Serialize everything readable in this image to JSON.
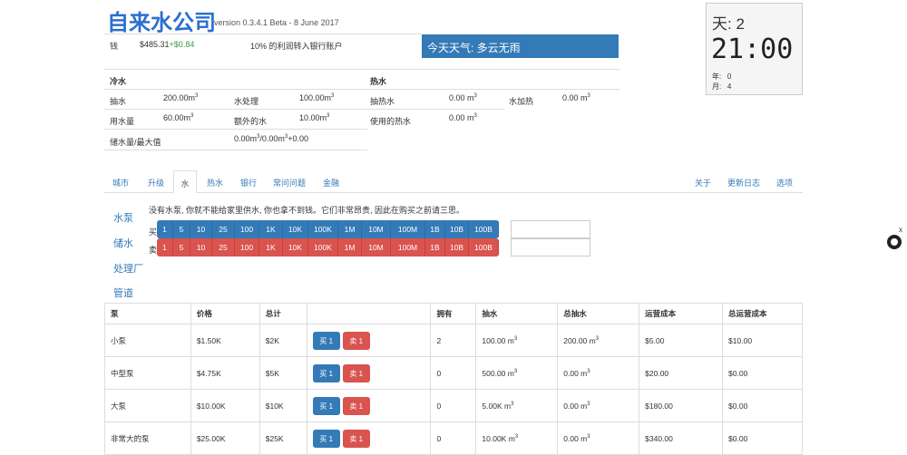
{
  "header": {
    "title": "自来水公司",
    "version": "version 0.3.4.1 Beta - 8 June 2017"
  },
  "money": {
    "label": "钱",
    "amount": "$485.31",
    "delta": "+$0.84",
    "bank_note": "10% 的利润转入银行账户"
  },
  "weather": {
    "text": "今天天气: 多云无雨"
  },
  "clock": {
    "day_label": "天: 2",
    "time": "21:00",
    "year_label": "年:",
    "year_value": "0",
    "month_label": "月:",
    "month_value": "4"
  },
  "cold": {
    "heading": "冷水",
    "pump_label": "抽水",
    "pump_value": "200.00m",
    "treat_label": "水处理",
    "treat_value": "100.00m",
    "usage_label": "用水量",
    "usage_value": "60.00m",
    "extra_label": "额外的水",
    "extra_value": "10.00m",
    "storage_label": "储水量/最大值",
    "storage_value_a": "0.00m",
    "storage_value_b": "/0.00m",
    "storage_value_c": "+0.00",
    "sup3": "3"
  },
  "hot": {
    "heading": "热水",
    "pump_label": "抽热水",
    "pump_value": "0.00 m",
    "heat_label": "水加热",
    "heat_value": "0.00 m",
    "used_label": "使用的热水",
    "used_value": "0.00 m"
  },
  "tabs": {
    "city": "城市",
    "upgrade": "升级",
    "water": "水",
    "hot_water": "热水",
    "bank": "银行",
    "faq": "常问问题",
    "finance": "金融",
    "about": "关于",
    "changelog": "更新日志",
    "options": "选项"
  },
  "side": {
    "pump": "水泵",
    "storage": "储水",
    "treatment": "处理厂",
    "pipe": "管道"
  },
  "notice": "没有水泵, 你就不能给家里供水, 你也拿不到钱。它们非常昂贵, 因此在购买之前请三思。",
  "quantity": {
    "buy_label": "买",
    "sell_label": "卖",
    "options": [
      "1",
      "5",
      "10",
      "25",
      "100",
      "1K",
      "10K",
      "100K",
      "1M",
      "10M",
      "100M",
      "1B",
      "10B",
      "100B"
    ]
  },
  "table": {
    "headers": [
      "泵",
      "价格",
      "总计",
      "",
      "拥有",
      "抽水",
      "总抽水",
      "运营成本",
      "总运营成本"
    ],
    "buy_btn": "买 1",
    "sell_btn": "卖 1",
    "rows": [
      {
        "name": "小泵",
        "price": "$1.50K",
        "total": "$2K",
        "owned": "2",
        "pump": "100.00 m",
        "total_pump": "200.00 m",
        "cost": "$5.00",
        "total_cost": "$10.00"
      },
      {
        "name": "中型泵",
        "price": "$4.75K",
        "total": "$5K",
        "owned": "0",
        "pump": "500.00 m",
        "total_pump": "0.00 m",
        "cost": "$20.00",
        "total_cost": "$0.00"
      },
      {
        "name": "大泵",
        "price": "$10.00K",
        "total": "$10K",
        "owned": "0",
        "pump": "5.00K m",
        "total_pump": "0.00 m",
        "cost": "$180.00",
        "total_cost": "$0.00"
      },
      {
        "name": "非常大的泵",
        "price": "$25.00K",
        "total": "$25K",
        "owned": "0",
        "pump": "10.00K m",
        "total_pump": "0.00 m",
        "cost": "$340.00",
        "total_cost": "$0.00"
      }
    ]
  },
  "github": {
    "close": "x"
  }
}
